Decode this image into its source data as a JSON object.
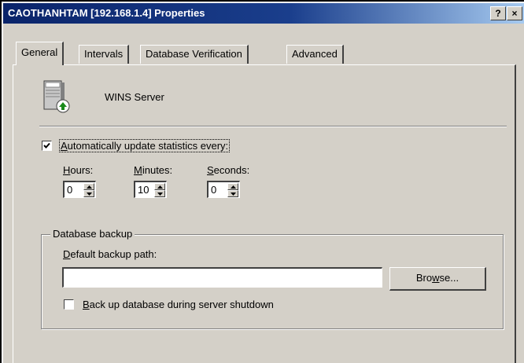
{
  "window": {
    "title": "CAOTHANHTAM [192.168.1.4] Properties",
    "help_button": "?",
    "close_button": "×"
  },
  "tabs": [
    {
      "label": "General",
      "active": true
    },
    {
      "label": "Intervals",
      "active": false
    },
    {
      "label": "Database Verification",
      "active": false
    },
    {
      "label": "Advanced",
      "active": false
    }
  ],
  "server": {
    "icon": "server-icon",
    "label": "WINS Server"
  },
  "stats": {
    "checkbox_checked": true,
    "label_ul": "A",
    "label_rest": "utomatically update statistics every:",
    "hours": {
      "label_ul": "H",
      "label_rest": "ours:",
      "value": "0"
    },
    "minutes": {
      "label_ul": "M",
      "label_rest": "inutes:",
      "value": "10"
    },
    "seconds": {
      "label_ul": "S",
      "label_rest": "econds:",
      "value": "0"
    }
  },
  "backup": {
    "group_title": "Database backup",
    "path_label_ul": "D",
    "path_label_rest": "efault backup path:",
    "path_value": "",
    "browse_pre": "Bro",
    "browse_ul": "w",
    "browse_post": "se...",
    "shutdown_checked": false,
    "shutdown_label_ul": "B",
    "shutdown_label_rest": "ack up database during server shutdown"
  }
}
